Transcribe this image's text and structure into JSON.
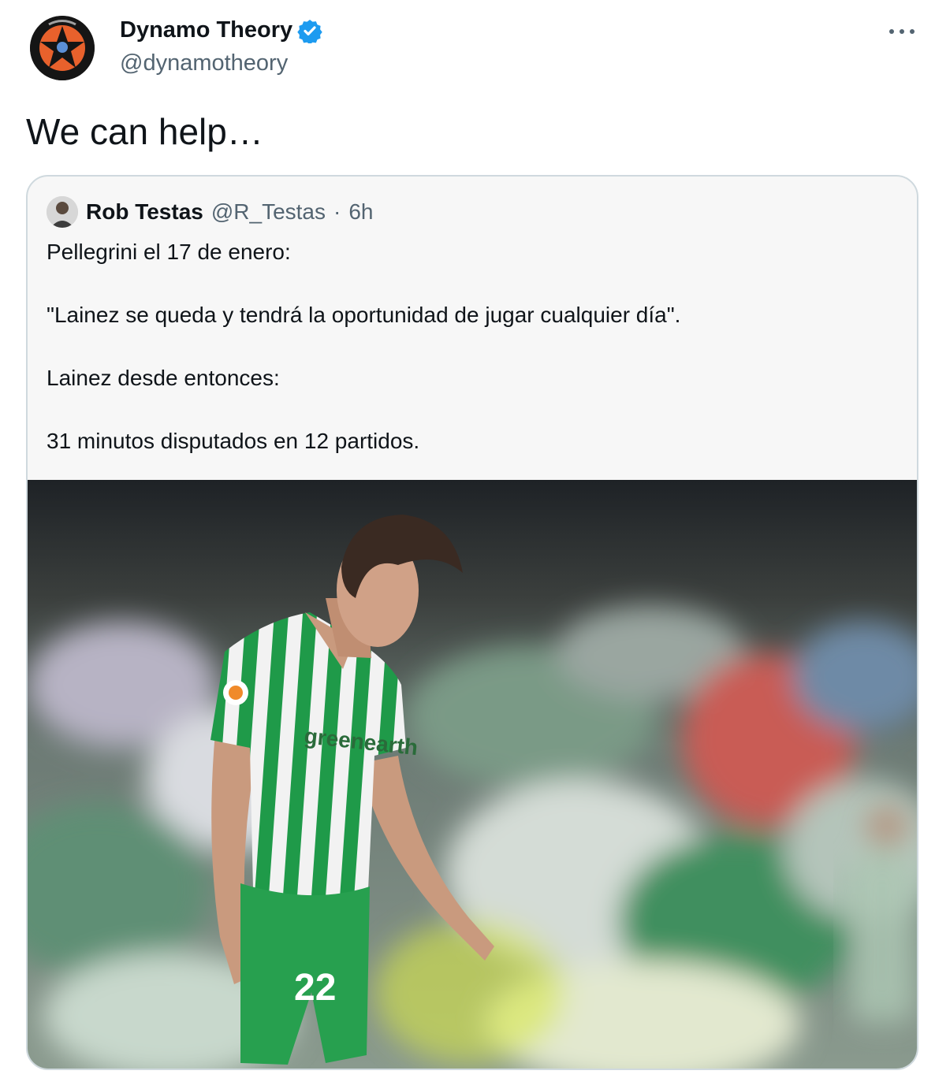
{
  "author": {
    "display_name": "Dynamo Theory",
    "handle": "@dynamotheory",
    "avatar_icon": "dynamo-theory-star-logo",
    "verified": true,
    "verified_color": "#1d9bf0"
  },
  "tweet": {
    "text": "We can help…"
  },
  "quoted": {
    "display_name": "Rob Testas",
    "handle": "@R_Testas",
    "separator": "·",
    "time": "6h",
    "lines": [
      "Pellegrini el 17 de enero:",
      "\"Lainez se queda y tendrá la oportunidad de jugar cualquier día\".",
      "Lainez desde entonces:",
      "31 minutos disputados en 12 partidos."
    ],
    "photo": {
      "jersey_sponsor": "greenearth",
      "jersey_number": "22"
    }
  },
  "colors": {
    "text": "#0f1419",
    "secondary": "#536471",
    "border": "#cfd9de",
    "jersey_green": "#1f9a49",
    "logo_orange": "#e8612c"
  }
}
